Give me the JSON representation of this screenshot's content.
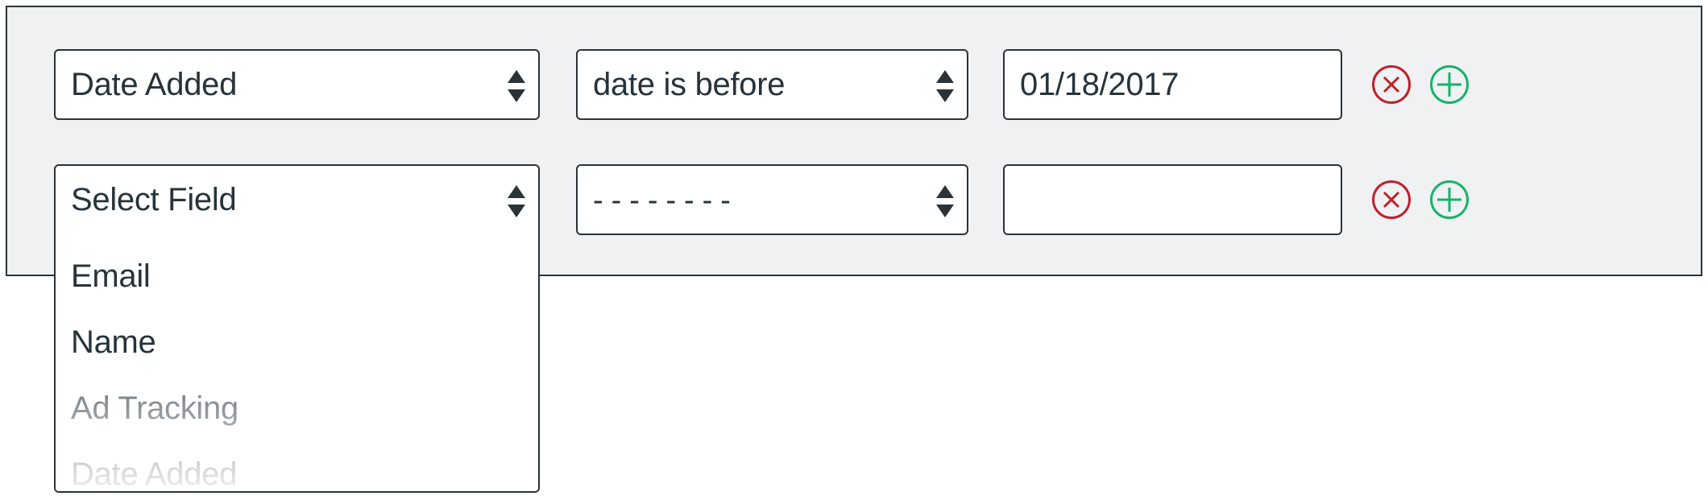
{
  "filter_rows": [
    {
      "field_select": {
        "value": "Date Added",
        "icon": "sort-arrows-icon"
      },
      "operator_select": {
        "value": "date is before",
        "icon": "sort-arrows-icon"
      },
      "value_input": {
        "value": "01/18/2017",
        "placeholder": ""
      },
      "remove_icon": "remove-circle-x-icon",
      "add_icon": "add-circle-plus-icon"
    },
    {
      "field_select": {
        "value": "Select Field",
        "icon": "sort-arrows-icon"
      },
      "operator_select": {
        "value": "- - - - - - - -",
        "icon": "sort-arrows-icon"
      },
      "value_input": {
        "value": "",
        "placeholder": ""
      },
      "remove_icon": "remove-circle-x-icon",
      "add_icon": "add-circle-plus-icon"
    }
  ],
  "field_dropdown": {
    "open": true,
    "options": [
      "Email",
      "Name",
      "Ad Tracking",
      "Date Added"
    ]
  },
  "colors": {
    "remove": "#c0202a",
    "add": "#17b26a",
    "text": "#26333b",
    "border": "#2a3338",
    "panel_bg": "#eff1f3"
  }
}
